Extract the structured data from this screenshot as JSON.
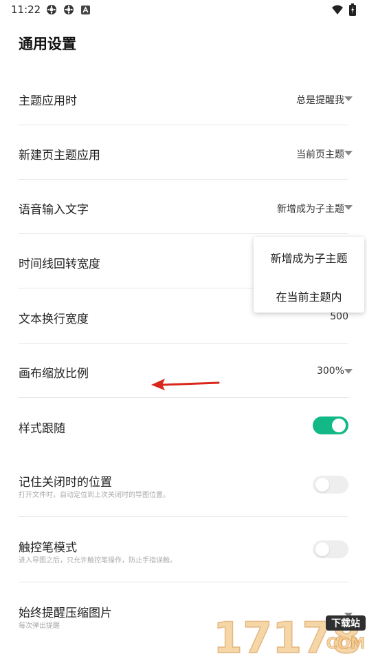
{
  "statusbar": {
    "time": "11:22",
    "icons_left": [
      "gear-icon",
      "gear-icon",
      "app-icon"
    ],
    "icons_right": [
      "wifi-icon",
      "battery-icon"
    ]
  },
  "page": {
    "title": "通用设置"
  },
  "settings": [
    {
      "label": "主题应用时",
      "value": "总是提醒我",
      "control": "dropdown"
    },
    {
      "label": "新建页主题应用",
      "value": "当前页主题",
      "control": "dropdown"
    },
    {
      "label": "语音输入文字",
      "value": "新增成为子主题",
      "control": "dropdown"
    },
    {
      "label": "时间线回转宽度",
      "value": "",
      "control": "dropdown"
    },
    {
      "label": "文本换行宽度",
      "value": "500",
      "control": "text"
    },
    {
      "label": "画布缩放比例",
      "value": "300%",
      "control": "dropdown"
    },
    {
      "label": "样式跟随",
      "sublabel": "",
      "control": "toggle",
      "on": true
    },
    {
      "label": "记住关闭时的位置",
      "sublabel": "打开文件时，自动定位到上次关闭时的导图位置。",
      "control": "toggle",
      "on": false
    },
    {
      "label": "触控笔模式",
      "sublabel": "进入导图之后，只允许触控笔操作，防止手指误触。",
      "control": "toggle",
      "on": false
    },
    {
      "label": "始终提醒压缩图片",
      "sublabel": "每次弹出提醒",
      "control": "dropdown"
    }
  ],
  "dropdown_menu": {
    "items": [
      "新增成为子主题",
      "在当前主题内"
    ]
  },
  "annotation": {
    "type": "red-arrow-pointing-left"
  },
  "watermark": {
    "text": "17178",
    "badge": "下载站",
    "domain": "COM"
  },
  "colors": {
    "accent": "#12b886",
    "arrow": "#d9261c"
  }
}
